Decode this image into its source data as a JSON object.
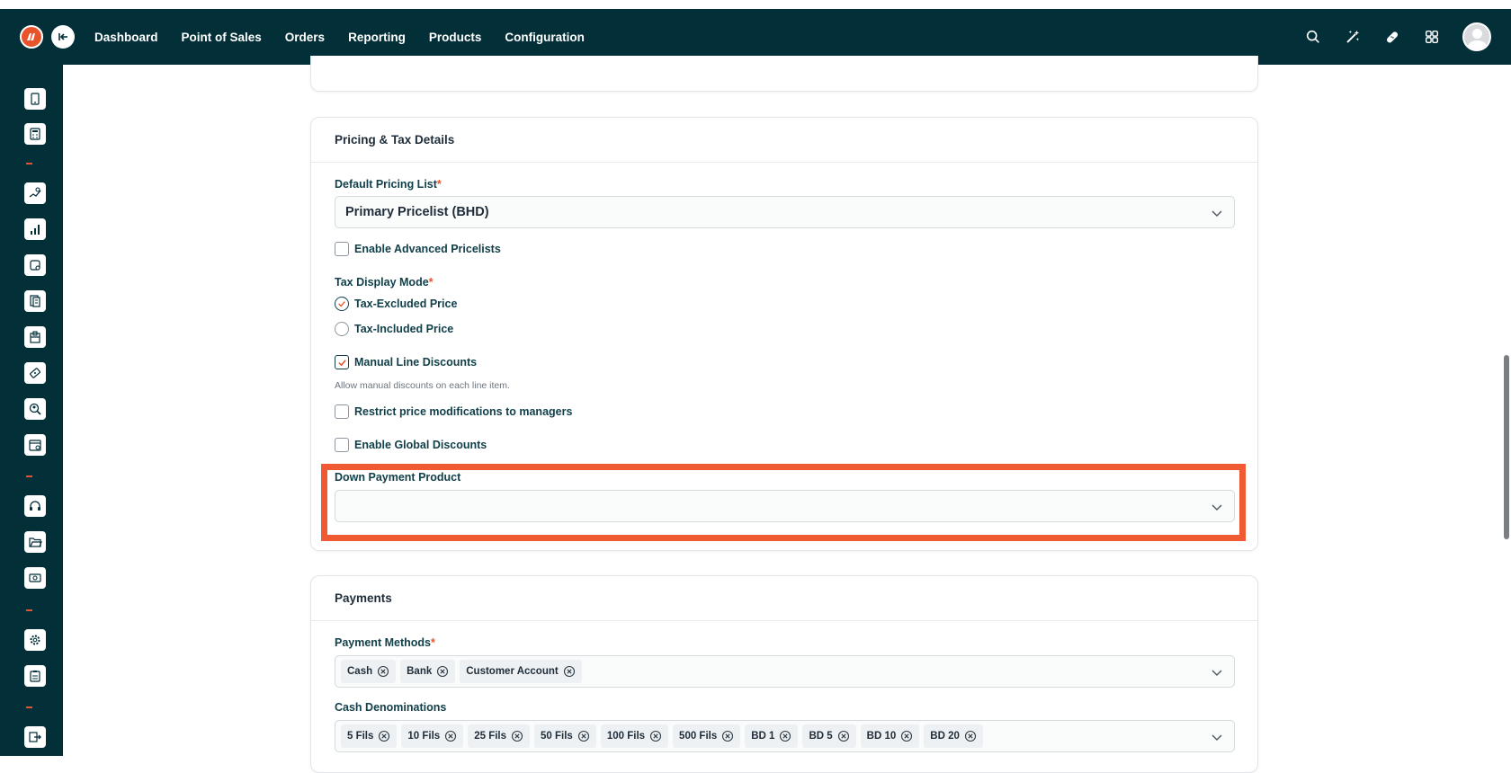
{
  "navbar": {
    "menu": [
      "Dashboard",
      "Point of Sales",
      "Orders",
      "Reporting",
      "Products",
      "Configuration"
    ]
  },
  "pricing": {
    "title": "Pricing & Tax Details",
    "default_pricing_label": "Default Pricing List",
    "default_pricing_value": "Primary Pricelist (BHD)",
    "advanced_pricelists": {
      "label": "Enable Advanced Pricelists",
      "checked": false
    },
    "tax_mode_label": "Tax Display Mode",
    "tax_options": [
      {
        "label": "Tax-Excluded Price",
        "selected": true
      },
      {
        "label": "Tax-Included Price",
        "selected": false
      }
    ],
    "manual_discounts": {
      "label": "Manual Line Discounts",
      "checked": true,
      "help": "Allow manual discounts on each line item."
    },
    "restrict_price": {
      "label": "Restrict price modifications to managers",
      "checked": false
    },
    "global_discounts": {
      "label": "Enable Global Discounts",
      "checked": false
    },
    "down_payment_label": "Down Payment Product",
    "down_payment_value": ""
  },
  "payments": {
    "title": "Payments",
    "methods_label": "Payment Methods",
    "methods": [
      "Cash",
      "Bank",
      "Customer Account"
    ],
    "denominations_label": "Cash Denominations",
    "denominations": [
      "5 Fils",
      "10 Fils",
      "25 Fils",
      "50 Fils",
      "100 Fils",
      "500 Fils",
      "BD 1",
      "BD 5",
      "BD 10",
      "BD 20"
    ]
  },
  "colors": {
    "nav_bg": "#022f38",
    "accent": "#e8532c",
    "highlight": "#f05a32"
  }
}
